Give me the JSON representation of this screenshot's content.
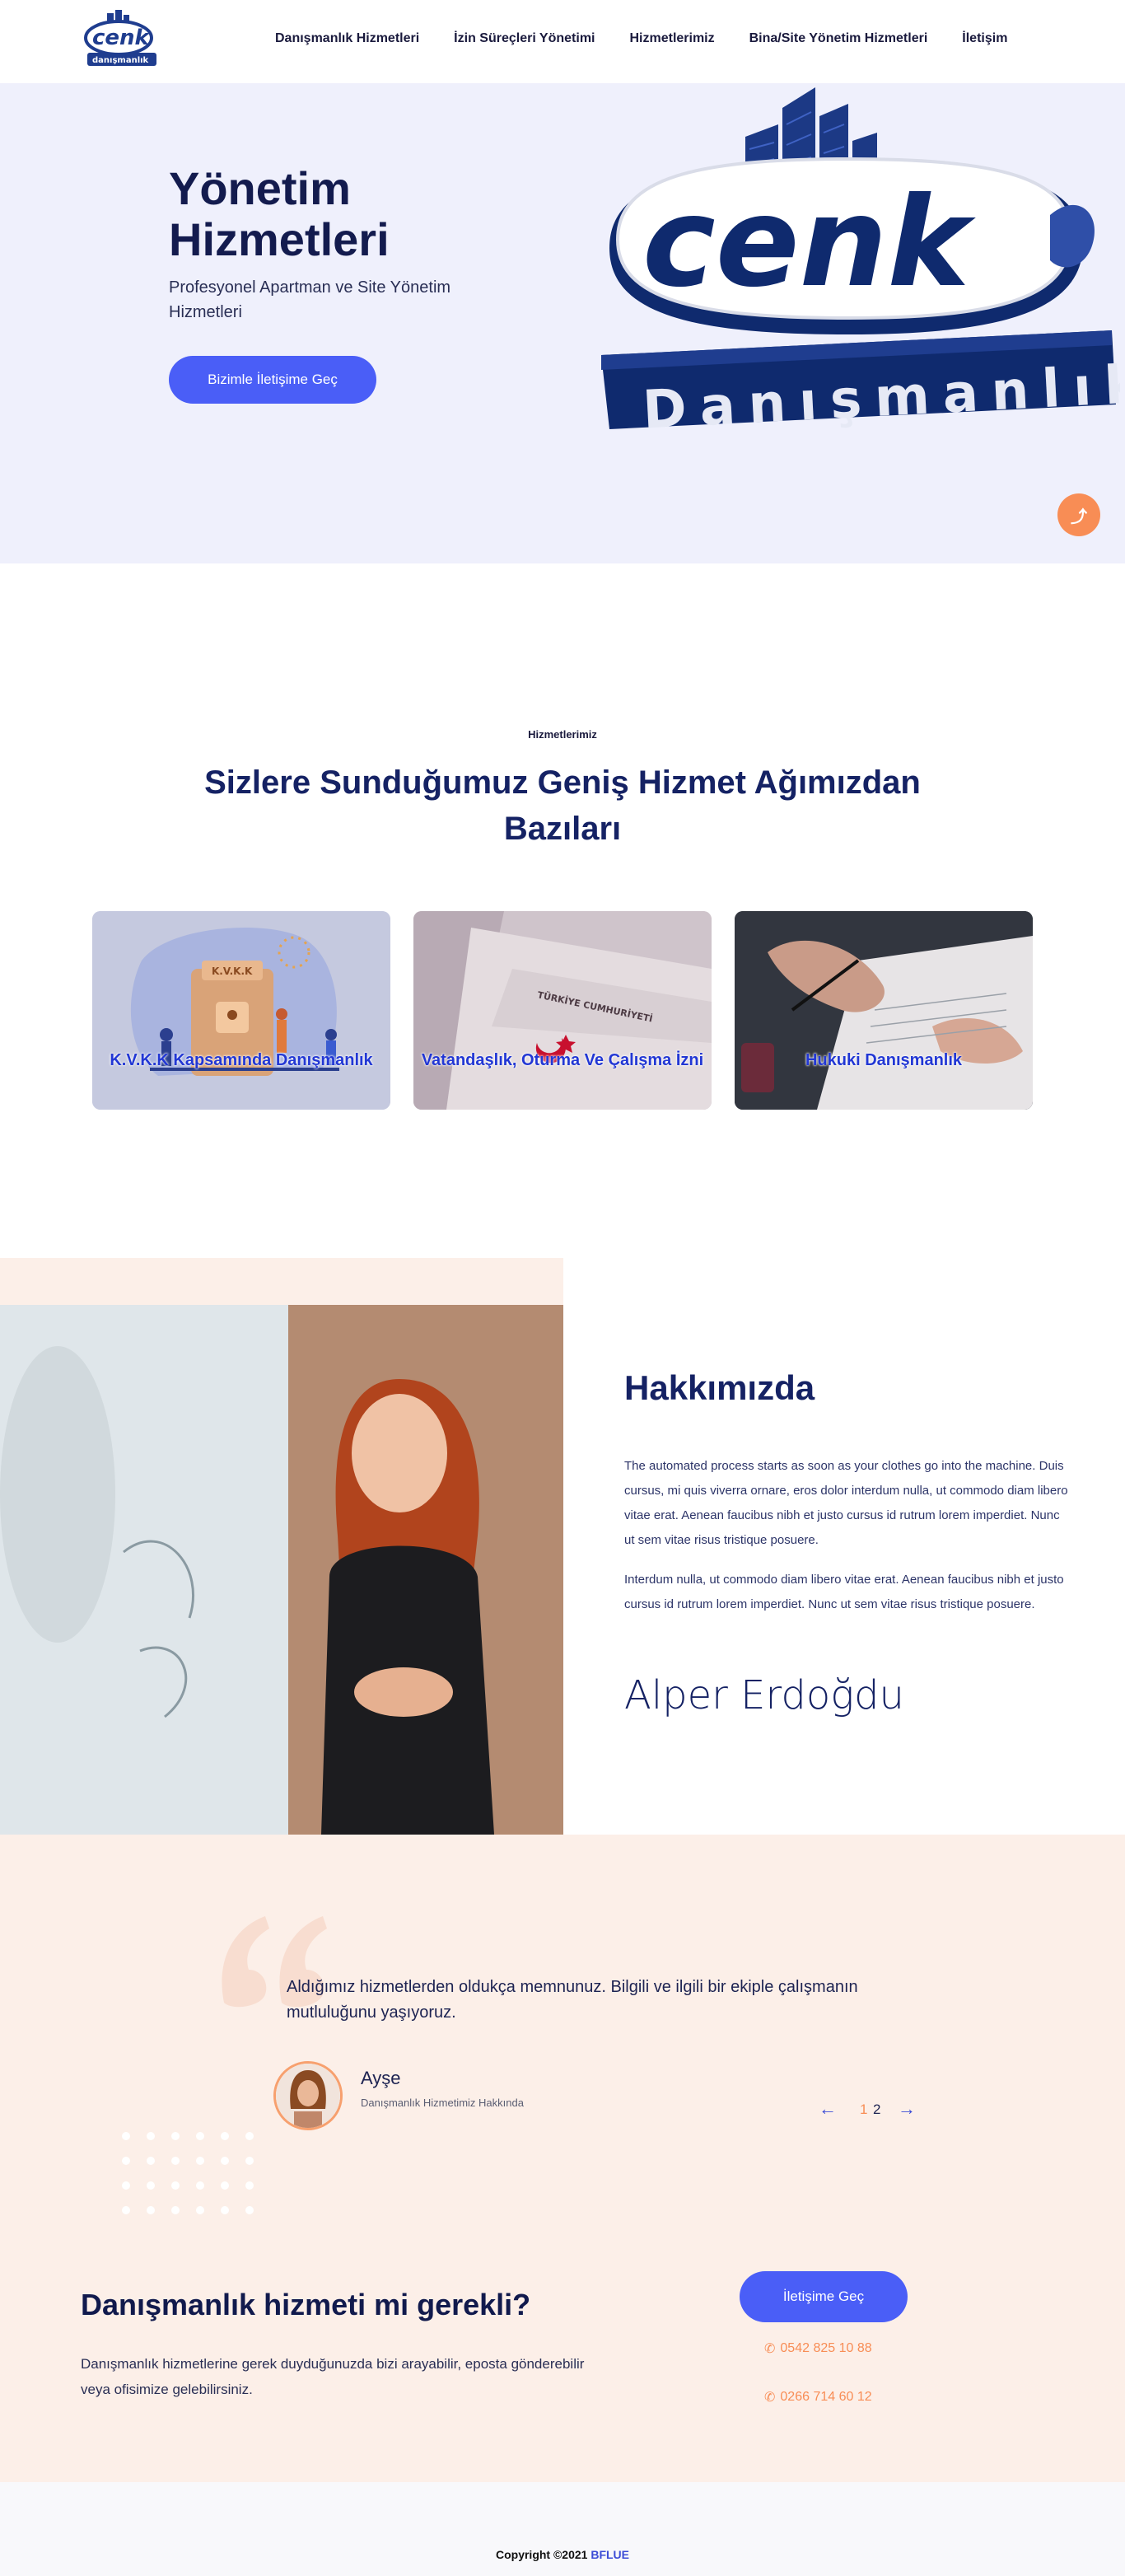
{
  "header": {
    "logo_text": "cenk",
    "logo_sub": "danışmanlık",
    "nav": [
      "Danışmanlık Hizmetleri",
      "İzin Süreçleri Yönetimi",
      "Hizmetlerimiz",
      "Bina/Site Yönetim Hizmetleri",
      "İletişim"
    ]
  },
  "hero": {
    "title": "Yönetim Hizmetleri",
    "subtitle": "Profesyonel Apartman ve Site Yönetim Hizmetleri",
    "button": "Bizimle İletişime Geç",
    "logo_main": "cenk",
    "logo_sub": "Danışmanlık"
  },
  "services": {
    "tag": "Hizmetlerimiz",
    "title": "Sizlere Sunduğumuz Geniş Hizmet Ağımızdan Bazıları",
    "cards": [
      {
        "label": "K.V.K.K Kapsamında Danışmanlık",
        "image_text": "K.V.K.K"
      },
      {
        "label": "Vatandaşlık, Oturma Ve Çalışma İzni",
        "image_text": "TÜRKİYE CUMHURİYETİ"
      },
      {
        "label": "Hukuki Danışmanlık"
      }
    ]
  },
  "about": {
    "title": "Hakkımızda",
    "p1": "The automated process starts as soon as your clothes go into the machine. Duis cursus, mi quis viverra ornare, eros dolor interdum nulla, ut commodo diam libero vitae erat. Aenean faucibus nibh et justo cursus id rutrum lorem imperdiet. Nunc ut sem vitae risus tristique posuere.",
    "p2": "Interdum nulla, ut commodo diam libero vitae erat. Aenean faucibus nibh et justo cursus id rutrum lorem imperdiet. Nunc ut sem vitae risus tristique posuere.",
    "signature": "Alper Erdoğdu"
  },
  "testimonial": {
    "text": "Aldığımız hizmetlerden oldukça memnunuz. Bilgili ve ilgili bir ekiple çalışmanın mutluluğunu yaşıyoruz.",
    "name": "Ayşe",
    "role": "Danışmanlık Hizmetimiz Hakkında",
    "prev": "←",
    "next": "→",
    "page_current": "1",
    "page_total": "2"
  },
  "cta": {
    "title": "Danışmanlık hizmeti mi gerekli?",
    "text": "Danışmanlık hizmetlerine gerek duyduğunuzda bizi arayabilir, eposta gönderebilir veya ofisimize gelebilirsiniz.",
    "button": "İletişime Geç",
    "phone1": "0542 825 10 88",
    "phone2": "0266 714 60 12"
  },
  "footer": {
    "copyright": "Copyright ©2021",
    "brand": "BFLUE"
  },
  "colors": {
    "accent": "#4a5ef7",
    "orange": "#f88d55",
    "navy": "#152264",
    "peach": "#fcefe8"
  }
}
